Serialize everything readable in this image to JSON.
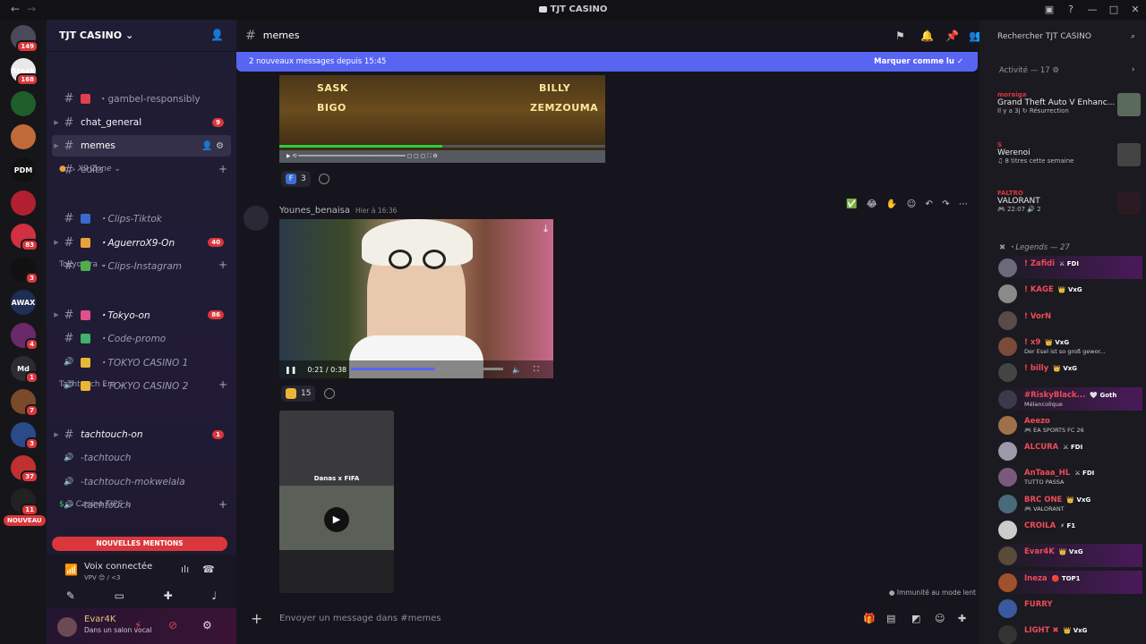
{
  "window": {
    "title": "TJT CASINO"
  },
  "rail": {
    "servers": [
      {
        "label": "",
        "badge": "149",
        "color": "#4a4a5a"
      },
      {
        "label": "Steak",
        "badge": "168",
        "color": "#e8e8e8"
      },
      {
        "label": "",
        "badge": "",
        "color": "#1f5e2a"
      },
      {
        "label": "",
        "badge": "",
        "color": "#c06a3a"
      },
      {
        "label": "PDM",
        "badge": "",
        "color": "#111"
      },
      {
        "label": "",
        "badge": "",
        "color": "#b02030"
      },
      {
        "label": "",
        "badge": "83",
        "color": "#d03040"
      },
      {
        "label": "",
        "badge": "3",
        "color": "#111"
      },
      {
        "label": "AWAX",
        "badge": "",
        "color": "#1f2e55"
      },
      {
        "label": "",
        "badge": "4",
        "color": "#6a2a6a"
      },
      {
        "label": "Md",
        "badge": "1",
        "color": "#2c2c34"
      },
      {
        "label": "",
        "badge": "7",
        "color": "#7a4a2a"
      },
      {
        "label": "",
        "badge": "3",
        "color": "#2a4a8a"
      },
      {
        "label": "",
        "badge": "37",
        "color": "#c03030"
      },
      {
        "label": "",
        "badge": "11",
        "color": "#222"
      }
    ],
    "new_badge": "NOUVEAU"
  },
  "guild": {
    "name": "TJT CASINO"
  },
  "channels": [
    {
      "type": "text",
      "label": "gambel-responsibly",
      "prefix": "・",
      "italic": false,
      "unread": false,
      "count": ""
    },
    {
      "type": "text",
      "label": "chat_general",
      "prefix": "",
      "italic": false,
      "unread": true,
      "count": "9"
    },
    {
      "type": "text",
      "label": "memes",
      "prefix": "",
      "italic": false,
      "unread": true,
      "count": "",
      "active": true
    },
    {
      "type": "text",
      "label": "edits",
      "prefix": "",
      "italic": false,
      "unread": false,
      "count": ""
    },
    {
      "type": "text",
      "label": "Clips-Tiktok",
      "prefix": "・",
      "italic": true,
      "unread": false,
      "count": ""
    },
    {
      "type": "text",
      "label": "AguerroX9-On",
      "prefix": "・",
      "italic": true,
      "unread": true,
      "count": "40"
    },
    {
      "type": "text",
      "label": "Clips-Instagram",
      "prefix": "・",
      "italic": true,
      "unread": false,
      "count": ""
    },
    {
      "type": "text",
      "label": "Tokyo-on",
      "prefix": "・",
      "italic": true,
      "unread": true,
      "count": "86"
    },
    {
      "type": "text",
      "label": "Code-promo",
      "prefix": "・",
      "italic": true,
      "unread": false,
      "count": ""
    },
    {
      "type": "voice",
      "label": "TOKYO CASINO 1",
      "prefix": "・",
      "italic": true,
      "unread": false,
      "count": ""
    },
    {
      "type": "voice",
      "label": "TOKYO CASINO 2",
      "prefix": "・",
      "italic": true,
      "unread": false,
      "count": ""
    },
    {
      "type": "text",
      "label": "tachtouch-on",
      "prefix": "",
      "italic": true,
      "unread": true,
      "count": "1"
    },
    {
      "type": "voice",
      "label": "-tachtouch",
      "prefix": "",
      "italic": true,
      "unread": false,
      "count": ""
    },
    {
      "type": "voice",
      "label": "-tachtouch-mokwelala",
      "prefix": "",
      "italic": true,
      "unread": false,
      "count": ""
    },
    {
      "type": "voice",
      "label": "-tachtouch",
      "prefix": "",
      "italic": true,
      "unread": false,
      "count": ""
    }
  ],
  "categories": {
    "x9": "X9 Zone",
    "tokyo": "Tokyo Era",
    "tachtouch": "Tachtouch Era",
    "casino": "Casino TIPS"
  },
  "sidebar": {
    "new_mentions": "NOUVELLES MENTIONS"
  },
  "voice": {
    "title": "Voix connectée",
    "sub": "VPV 😊 / <3"
  },
  "user": {
    "name": "Evar4K",
    "status": "Dans un salon vocal"
  },
  "header": {
    "channel": "memes"
  },
  "newbar": {
    "text": "2 nouveaux messages depuis 15:45",
    "mark": "Marquer comme lu"
  },
  "msg1": {
    "names": [
      "SASK",
      "BIGO",
      "BILLY",
      "ZEMZOUMA"
    ],
    "progress": 0.5,
    "reaction_emoji": "F",
    "reaction_count": "3"
  },
  "msg2": {
    "author": "Younes_benaisa",
    "time": "Hier à 16:36",
    "video_time": "0:21 / 0:38",
    "progress": 0.55,
    "reaction_count": "15"
  },
  "msg3": {
    "caption": "Danas x FIFA"
  },
  "slowmode": "Immunité au mode lent",
  "composer": {
    "placeholder": "Envoyer un message dans #memes"
  },
  "search": {
    "placeholder": "Rechercher TJT CASINO"
  },
  "activity": {
    "header": "Activité — 17",
    "items": [
      {
        "name": "moraiga",
        "game": "Grand Theft Auto V Enhanc...",
        "sub": "Il y a 3j  ↻ Résurrection",
        "thumb": "#5a6a5a"
      },
      {
        "name": "S",
        "game": "Werenoi",
        "sub": "♫ 8 titres cette semaine",
        "thumb": "#444"
      },
      {
        "name": "FALTRO",
        "game": "VALORANT",
        "sub": "🎮 22:07  🔊 2",
        "thumb": "#2a1a22"
      }
    ]
  },
  "legends": {
    "header": "Legends — 27",
    "members": [
      {
        "name": "! Zafidi",
        "tag": "⚔ FDI",
        "sub": "",
        "color": "#f04a5a",
        "hl": true
      },
      {
        "name": "! KAGE",
        "tag": "👑 VxG",
        "sub": "",
        "color": "#f04a5a",
        "hl": false
      },
      {
        "name": "! VorN",
        "tag": "",
        "sub": "",
        "color": "#f04a5a",
        "hl": false
      },
      {
        "name": "! x9",
        "tag": "👑 VxG",
        "sub": "Der Esel ist so groß gewor...",
        "color": "#f04a5a",
        "hl": false
      },
      {
        "name": "! billy",
        "tag": "👑 VxG",
        "sub": "",
        "color": "#f04a5a",
        "hl": false
      },
      {
        "name": "#RiskyBlack...",
        "tag": "🤍 Goth",
        "sub": "Mélancolique",
        "color": "#f04a5a",
        "hl": true
      },
      {
        "name": "Aeezo",
        "tag": "",
        "sub": "🎮 EA SPORTS FC 26",
        "color": "#f04a5a",
        "hl": false
      },
      {
        "name": "ALCURA",
        "tag": "⚔ FDI",
        "sub": "",
        "color": "#f04a5a",
        "hl": false
      },
      {
        "name": "AnTaaa_HL",
        "tag": "⚔ FDI",
        "sub": "TUTTO PASSA",
        "color": "#f04a5a",
        "hl": false
      },
      {
        "name": "BRC ONE",
        "tag": "👑 VxG",
        "sub": "🎮 VALORANT",
        "color": "#f04a5a",
        "hl": false
      },
      {
        "name": "CROILA",
        "tag": "⚡ F1",
        "sub": "",
        "color": "#f04a5a",
        "hl": false
      },
      {
        "name": "Evar4K",
        "tag": "👑 VxG",
        "sub": "",
        "color": "#f04a5a",
        "hl": true
      },
      {
        "name": "Ineza",
        "tag": "🔴 TOP1",
        "sub": "",
        "color": "#f04a5a",
        "hl": true
      },
      {
        "name": "FURRY",
        "tag": "",
        "sub": "",
        "color": "#f04a5a",
        "hl": false
      },
      {
        "name": "LIGHT ✖",
        "tag": "👑 VxG",
        "sub": "",
        "color": "#f04a5a",
        "hl": false
      }
    ]
  },
  "colors": {
    "accent": "#5865f2",
    "danger": "#da373c"
  }
}
